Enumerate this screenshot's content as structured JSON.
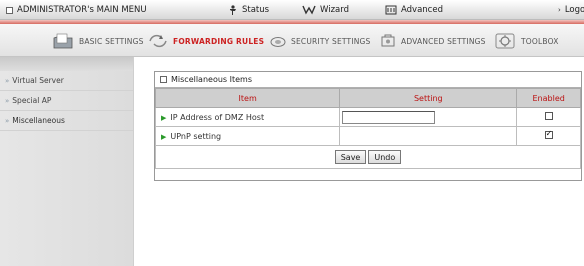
{
  "top_nav": {
    "title": "ADMINISTRATOR's MAIN MENU",
    "status": "Status",
    "wizard": "Wizard",
    "advanced": "Advanced",
    "logout": "Logout"
  },
  "tabs": [
    {
      "label": "BASIC SETTINGS",
      "icon": "folder-icon"
    },
    {
      "label": "FORWARDING RULES",
      "icon": "forwarding-icon",
      "active": true
    },
    {
      "label": "SECURITY SETTINGS",
      "icon": "security-icon"
    },
    {
      "label": "ADVANCED SETTINGS",
      "icon": "advanced-settings-icon"
    },
    {
      "label": "TOOLBOX",
      "icon": "toolbox-icon"
    }
  ],
  "sidebar": {
    "items": [
      {
        "label": "Virtual Server"
      },
      {
        "label": "Special AP"
      },
      {
        "label": "Miscellaneous",
        "active": true
      }
    ]
  },
  "panel": {
    "title": "Miscellaneous Items",
    "headers": {
      "item": "Item",
      "setting": "Setting",
      "enabled": "Enabled"
    },
    "rows": [
      {
        "label": "IP Address of DMZ Host",
        "value": "",
        "enabled": false
      },
      {
        "label": "UPnP setting",
        "enabled": true
      }
    ],
    "save_label": "Save",
    "undo_label": "Undo"
  },
  "colors": {
    "accent_red": "#cc2222",
    "header_red": "#bb1111",
    "bullet_green": "#2a9a2a"
  }
}
